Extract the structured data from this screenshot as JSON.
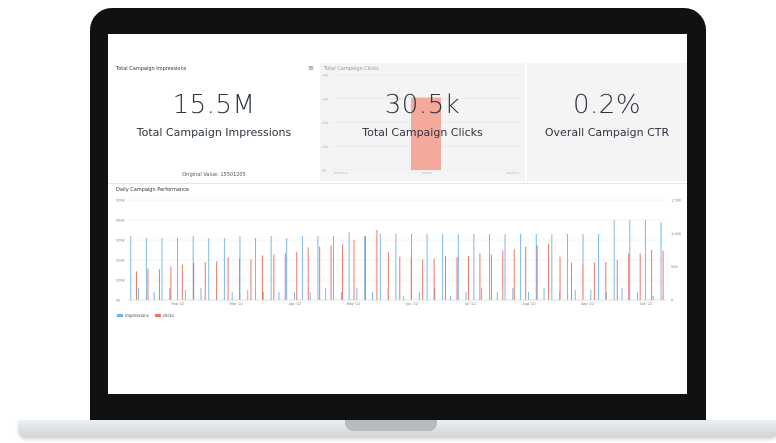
{
  "kpis": {
    "impressions": {
      "panel_title": "Total Campaign Impressions",
      "value": "15.5M",
      "label": "Total Campaign Impressions",
      "original_value": "Original Value: 15501205"
    },
    "clicks": {
      "panel_title": "Total Campaign Clicks",
      "value": "30.5k",
      "label": "Total Campaign Clicks"
    },
    "ctr": {
      "value": "0.2%",
      "label": "Overall Campaign CTR"
    }
  },
  "menu_icon": "≡",
  "colors": {
    "impressions": "#6fb1e8",
    "clicks": "#f07566",
    "clicks_bar_faded": "#f4a99c",
    "text": "#2c3540"
  },
  "daily_performance": {
    "title": "Daily Campaign Performance",
    "legend": [
      {
        "name": "impressions",
        "color": "#6fb1e8"
      },
      {
        "name": "clicks",
        "color": "#f07566"
      }
    ]
  },
  "chart_data": [
    {
      "type": "bar",
      "title": "Total Campaign Clicks",
      "categories": [
        "30.475 1",
        "30.475",
        "30.475 1"
      ],
      "values": [
        0,
        30500,
        0
      ],
      "y_ticks": [
        "40k",
        "30k",
        "20k",
        "10k",
        "0k"
      ],
      "ylim": [
        0,
        40000
      ]
    },
    {
      "type": "bar",
      "title": "Daily Campaign Performance",
      "x_ticks": [
        "Feb '22",
        "Mar '22",
        "Apr '22",
        "May '22",
        "Jun '22",
        "Jul '22",
        "Aug '22",
        "Sep '22",
        "Oct '22"
      ],
      "y_left_ticks": [
        "500k",
        "400k",
        "300k",
        "200k",
        "100k",
        "0k"
      ],
      "y_right_ticks": [
        "1,500",
        "1,000",
        "500",
        "0"
      ],
      "ylim_left": [
        0,
        500000
      ],
      "ylim_right": [
        0,
        1500
      ],
      "series": [
        {
          "name": "impressions",
          "axis": "left",
          "values": [
            320000,
            60000,
            310000,
            40000,
            310000,
            60000,
            310000,
            50000,
            320000,
            60000,
            310000,
            30000,
            310000,
            40000,
            320000,
            50000,
            310000,
            40000,
            320000,
            40000,
            310000,
            40000,
            320000,
            40000,
            320000,
            60000,
            320000,
            40000,
            340000,
            60000,
            320000,
            40000,
            330000,
            60000,
            330000,
            20000,
            330000,
            40000,
            330000,
            60000,
            330000,
            20000,
            330000,
            40000,
            330000,
            60000,
            330000,
            40000,
            330000,
            60000,
            330000,
            40000,
            330000,
            60000,
            330000,
            40000,
            330000,
            50000,
            330000,
            50000,
            330000,
            40000,
            400000,
            60000,
            400000,
            40000,
            400000,
            20000,
            390000
          ],
          "note": "interleaved daily bars"
        },
        {
          "name": "clicks",
          "axis": "right",
          "values": [
            430,
            470,
            460,
            500,
            530,
            560,
            570,
            580,
            640,
            620,
            610,
            670,
            680,
            700,
            720,
            790,
            800,
            820,
            830,
            900,
            960,
            1050,
            720,
            650,
            640,
            610,
            620,
            660,
            640,
            660,
            700,
            680,
            740,
            760,
            800,
            820,
            840,
            650,
            560,
            540,
            560,
            570,
            600,
            700,
            700,
            750,
            740
          ],
          "note": "daily bars"
        }
      ]
    }
  ]
}
